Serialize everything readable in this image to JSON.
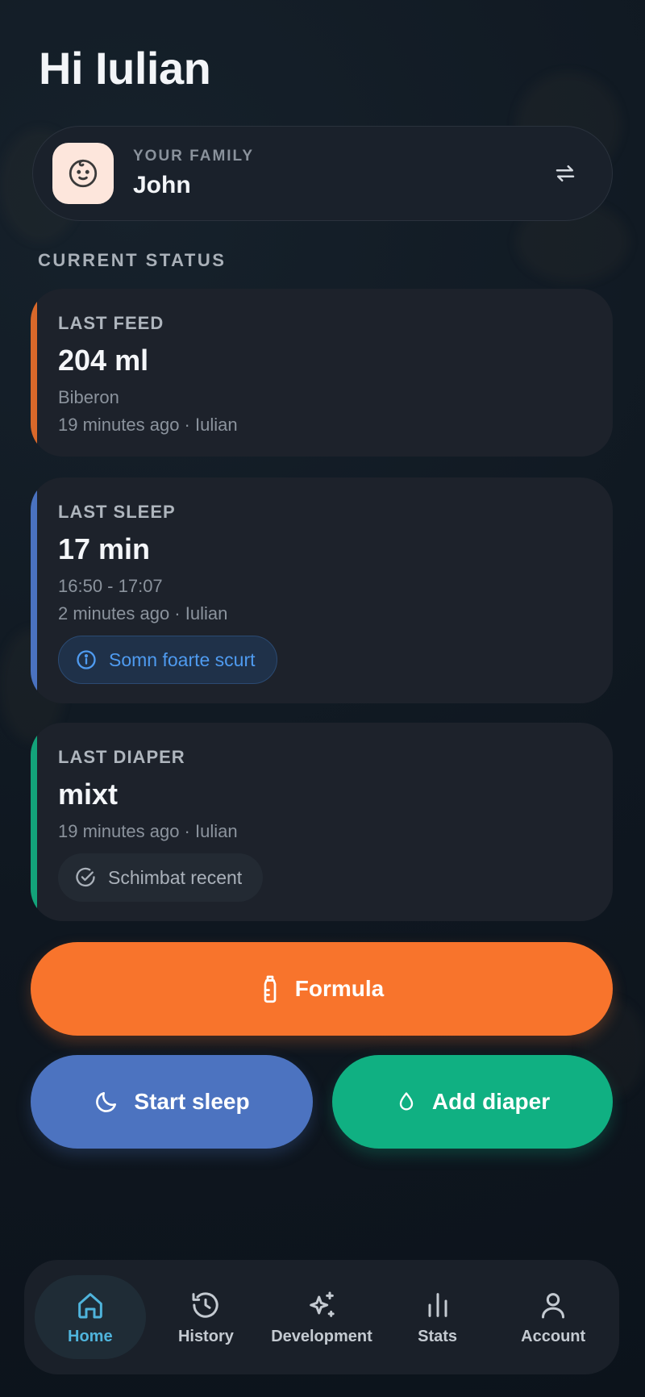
{
  "greeting": "Hi Iulian",
  "family": {
    "label": "YOUR FAMILY",
    "name": "John",
    "avatar_icon": "baby-face-icon",
    "switch_icon": "switch-arrows-icon"
  },
  "section_title": "CURRENT STATUS",
  "cards": {
    "feed": {
      "label": "LAST FEED",
      "value": "204 ml",
      "detail": "Biberon",
      "time": "19 minutes ago · Iulian",
      "accent": "#d9682a"
    },
    "sleep": {
      "label": "LAST SLEEP",
      "value": "17 min",
      "detail": "16:50 - 17:07",
      "time": "2 minutes ago · Iulian",
      "chip": "Somn foarte scurt",
      "accent": "#4a72c0"
    },
    "diaper": {
      "label": "LAST DIAPER",
      "value": "mixt",
      "time": "19 minutes ago · Iulian",
      "chip": "Schimbat recent",
      "accent": "#13a37a"
    }
  },
  "actions": {
    "formula": "Formula",
    "sleep": "Start sleep",
    "diaper": "Add diaper"
  },
  "colors": {
    "formula": "#f8742c",
    "sleep": "#4c73c0",
    "diaper": "#10b082",
    "nav_active": "#4fb4dc"
  },
  "nav": {
    "home": "Home",
    "history": "History",
    "development": "Development",
    "stats": "Stats",
    "account": "Account",
    "active": "Home"
  }
}
